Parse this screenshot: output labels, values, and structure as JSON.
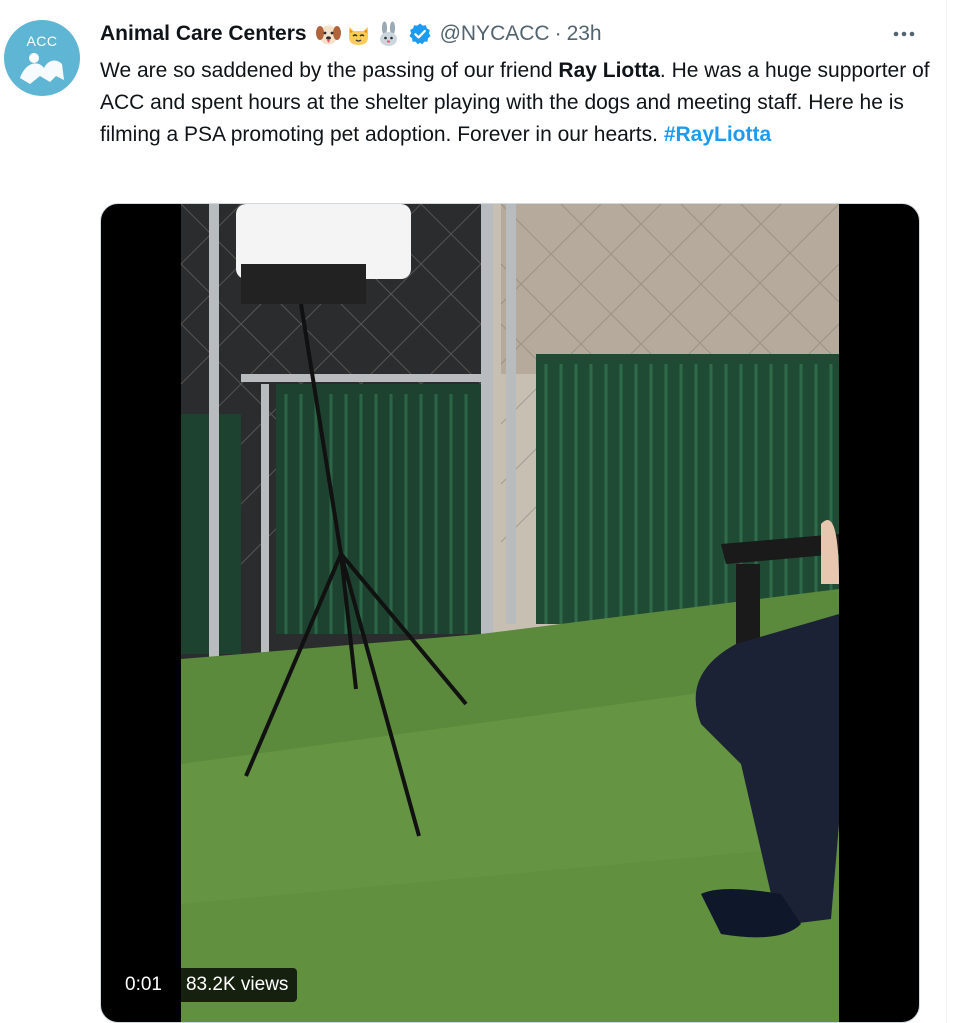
{
  "tweet": {
    "author": {
      "display_name": "Animal Care Centers",
      "handle": "@NYCACC",
      "avatar_text": "ACC",
      "verified": true,
      "name_emojis": [
        "dog-face-emoji",
        "cat-face-emoji",
        "rabbit-emoji"
      ]
    },
    "separator": "·",
    "time": "23h",
    "more_icon": "more-dots-icon",
    "text": {
      "part1": "We are so saddened by the passing of our friend ",
      "bold": "Ray Liotta",
      "part2": ". He was a huge supporter of ACC and spent hours at the shelter playing with the dogs and meeting staff. Here he is filming a PSA promoting pet adoption. Forever in our hearts. ",
      "hashtag": "#RayLiotta"
    },
    "video": {
      "timestamp": "0:01",
      "views": "83.2K views"
    }
  },
  "colors": {
    "link": "#1d9bf0",
    "secondary_text": "#536471",
    "primary_text": "#0f1419",
    "verified_badge": "#1d9bf0",
    "avatar_bg": "#5fb6d4"
  }
}
